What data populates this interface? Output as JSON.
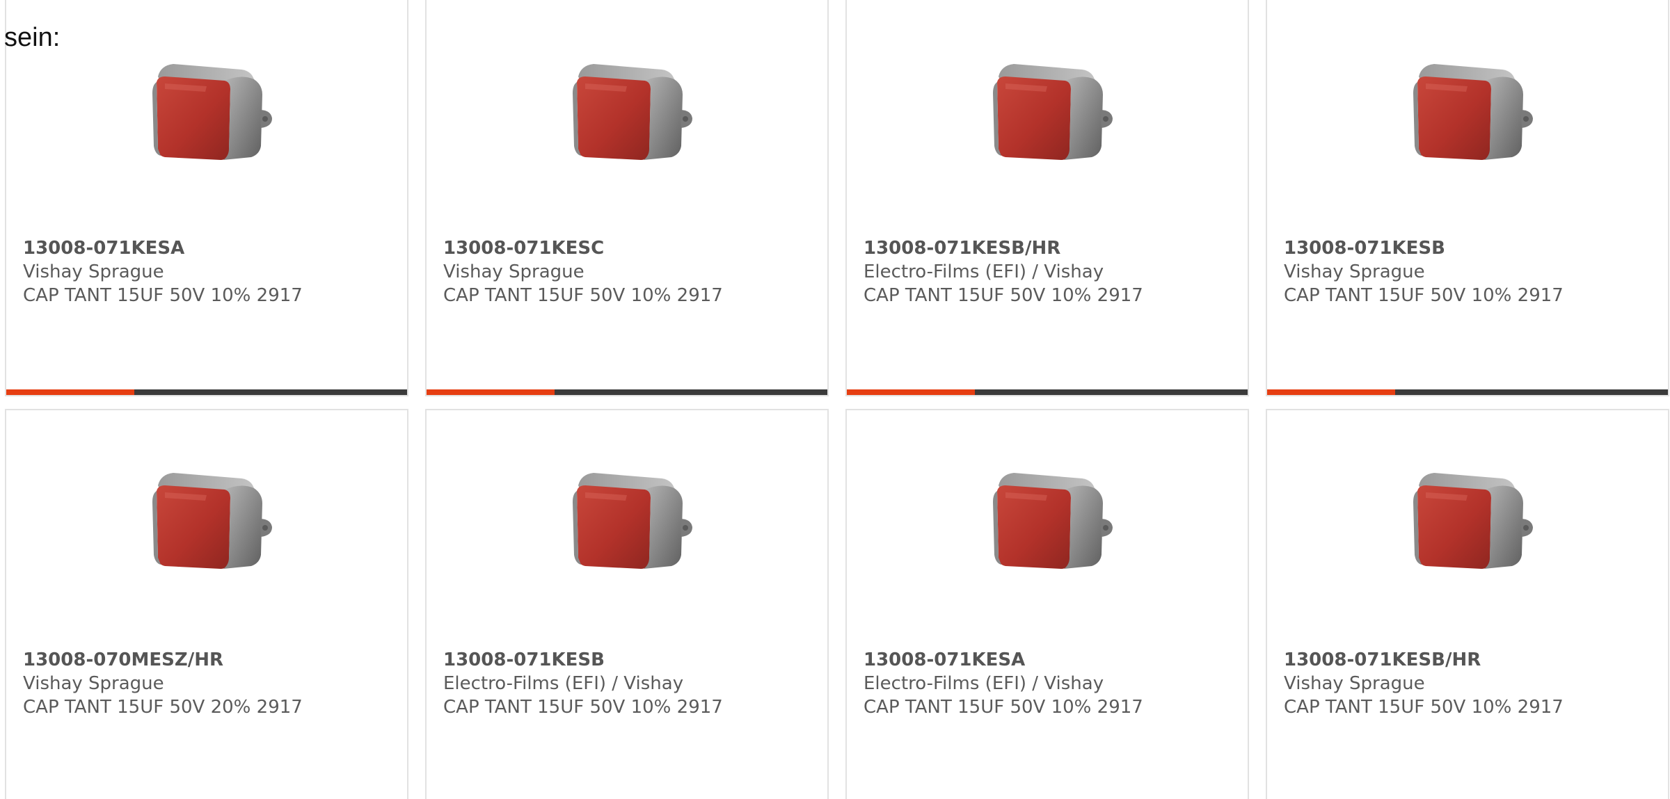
{
  "intro_text": "sein:",
  "colors": {
    "accent": "#e63e12",
    "bar_track": "#3b3b3b",
    "card_border": "#e2e2e2",
    "capacitor_body": "#b8352c",
    "capacitor_terminal": "#8e8e8e"
  },
  "image_icon": "tantalum-capacitor-photo",
  "products": [
    {
      "part": "13008-071KESA",
      "manufacturer": "Vishay Sprague",
      "description": "CAP TANT 15UF 50V 10% 2917",
      "bar_progress": 0.32
    },
    {
      "part": "13008-071KESC",
      "manufacturer": "Vishay Sprague",
      "description": "CAP TANT 15UF 50V 10% 2917",
      "bar_progress": 0.32
    },
    {
      "part": "13008-071KESB/HR",
      "manufacturer": "Electro-Films (EFI) / Vishay",
      "description": "CAP TANT 15UF 50V 10% 2917",
      "bar_progress": 0.32
    },
    {
      "part": "13008-071KESB",
      "manufacturer": "Vishay Sprague",
      "description": "CAP TANT 15UF 50V 10% 2917",
      "bar_progress": 0.32
    },
    {
      "part": "13008-070MESZ/HR",
      "manufacturer": "Vishay Sprague",
      "description": "CAP TANT 15UF 50V 20% 2917"
    },
    {
      "part": "13008-071KESB",
      "manufacturer": "Electro-Films (EFI) / Vishay",
      "description": "CAP TANT 15UF 50V 10% 2917"
    },
    {
      "part": "13008-071KESA",
      "manufacturer": "Electro-Films (EFI) / Vishay",
      "description": "CAP TANT 15UF 50V 10% 2917"
    },
    {
      "part": "13008-071KESB/HR",
      "manufacturer": "Vishay Sprague",
      "description": "CAP TANT 15UF 50V 10% 2917"
    }
  ]
}
